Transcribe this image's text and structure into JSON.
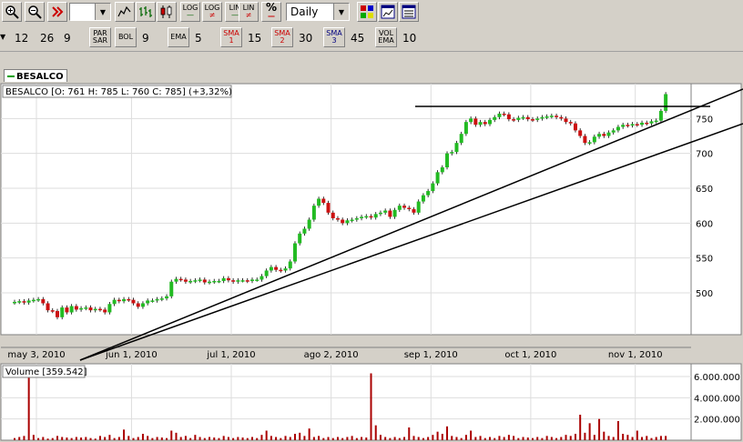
{
  "toolbar1": {
    "log1": "LOG",
    "log2": "LOG",
    "lin1": "LIN",
    "lin2": "LIN",
    "pct": "%",
    "period": "Daily"
  },
  "toolbar2": {
    "p1": "12",
    "p2": "26",
    "p3": "9",
    "par_sar": "PAR SAR",
    "bol": "BOL",
    "bol_v": "9",
    "ema": "EMA",
    "ema_v": "5",
    "sma1": "SMA 1",
    "sma1_v": "15",
    "sma2": "SMA 2",
    "sma2_v": "30",
    "sma3": "SMA 3",
    "sma3_v": "45",
    "vol_ema": "VOL EMA",
    "vol_ema_v": "10"
  },
  "tab_label": "BESALCO",
  "colors": {
    "up": "#22bb22",
    "down": "#cc1111",
    "volume": "#aa0000",
    "background": "#ffffff",
    "grid": "#dddddd"
  },
  "chart_data": [
    {
      "type": "candlestick",
      "legend": "BESALCO [O: 761  H: 785  L: 760  C: 785] (+3,32%)",
      "ylim": [
        440,
        800
      ],
      "y_ticks": [
        500,
        550,
        600,
        650,
        700,
        750
      ],
      "x_tick_labels": [
        "may 3, 2010",
        "jun 1, 2010",
        "jul 1, 2010",
        "ago 2, 2010",
        "sep 1, 2010",
        "oct 1, 2010",
        "nov 1, 2010"
      ],
      "x_tick_index": [
        0,
        20,
        41,
        62,
        83,
        104,
        126
      ],
      "close": [
        487,
        488,
        486,
        489,
        490,
        491,
        485,
        475,
        474,
        465,
        479,
        472,
        481,
        476,
        478,
        479,
        475,
        477,
        476,
        472,
        484,
        490,
        488,
        491,
        490,
        485,
        480,
        485,
        489,
        489,
        491,
        492,
        495,
        516,
        520,
        519,
        516,
        517,
        518,
        519,
        515,
        516,
        517,
        517,
        521,
        518,
        516,
        518,
        518,
        517,
        519,
        519,
        524,
        532,
        537,
        533,
        532,
        535,
        545,
        571,
        585,
        592,
        605,
        625,
        635,
        629,
        615,
        607,
        605,
        600,
        604,
        605,
        607,
        609,
        610,
        608,
        613,
        615,
        618,
        609,
        619,
        625,
        622,
        620,
        615,
        631,
        640,
        646,
        657,
        673,
        680,
        700,
        702,
        715,
        728,
        745,
        750,
        741,
        745,
        742,
        748,
        752,
        757,
        756,
        749,
        748,
        751,
        752,
        749,
        748,
        750,
        752,
        753,
        754,
        752,
        750,
        745,
        743,
        733,
        725,
        715,
        716,
        724,
        728,
        725,
        730,
        733,
        738,
        741,
        740,
        742,
        741,
        744,
        743,
        746,
        747,
        761,
        785
      ],
      "open_note": "open values follow the previous close"
    },
    {
      "type": "bar",
      "legend": "Volume [359.542]",
      "ylim": [
        0,
        7200000
      ],
      "y_ticks": [
        2000000,
        4000000,
        6000000
      ],
      "y_tick_labels": [
        "2.000.000",
        "4.000.000",
        "6.000.000"
      ],
      "values": [
        200000,
        300000,
        400000,
        6800000,
        500000,
        200000,
        300000,
        150000,
        200000,
        400000,
        300000,
        250000,
        200000,
        300000,
        250000,
        300000,
        200000,
        150000,
        400000,
        300000,
        500000,
        200000,
        300000,
        1000000,
        400000,
        200000,
        300000,
        600000,
        400000,
        200000,
        300000,
        250000,
        200000,
        900000,
        700000,
        300000,
        400000,
        200000,
        500000,
        300000,
        200000,
        300000,
        250000,
        200000,
        400000,
        300000,
        200000,
        300000,
        250000,
        200000,
        300000,
        200000,
        500000,
        900000,
        400000,
        300000,
        200000,
        400000,
        300000,
        600000,
        700000,
        400000,
        1100000,
        300000,
        400000,
        200000,
        300000,
        200000,
        300000,
        200000,
        300000,
        400000,
        200000,
        300000,
        250000,
        6300000,
        1400000,
        500000,
        300000,
        200000,
        300000,
        200000,
        300000,
        1200000,
        400000,
        300000,
        200000,
        300000,
        500000,
        800000,
        600000,
        1300000,
        400000,
        300000,
        200000,
        500000,
        900000,
        300000,
        400000,
        200000,
        300000,
        200000,
        400000,
        300000,
        500000,
        400000,
        200000,
        300000,
        250000,
        200000,
        300000,
        200000,
        400000,
        300000,
        200000,
        300000,
        500000,
        400000,
        600000,
        2400000,
        700000,
        1600000,
        500000,
        2000000,
        800000,
        400000,
        300000,
        1800000,
        600000,
        500000,
        300000,
        900000,
        300000,
        400000,
        200000,
        300000,
        400000,
        400000
      ]
    }
  ]
}
